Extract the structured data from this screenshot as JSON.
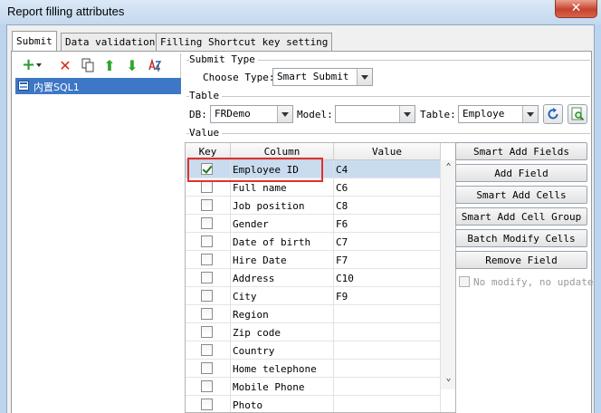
{
  "window": {
    "title": "Report filling attributes",
    "close_glyph": "✕"
  },
  "tabs": [
    {
      "label": "Submit",
      "active": true
    },
    {
      "label": "Data validation",
      "active": false
    },
    {
      "label": "Filling Shortcut key setting",
      "active": false
    }
  ],
  "toolbar": {
    "icons": [
      "add-dropdown-icon",
      "delete-icon",
      "copy-icon",
      "move-up-icon",
      "move-down-icon",
      "sort-icon"
    ],
    "add_glyph": "+",
    "delete_glyph": "✕",
    "up_glyph": "⬆",
    "down_glyph": "⬇"
  },
  "submit_list": {
    "items": [
      {
        "label": "内置SQL1",
        "selected": true
      }
    ]
  },
  "submit_type": {
    "group_label": "Submit Type",
    "choose_label": "Choose Type:",
    "value": "Smart Submit"
  },
  "table_group": {
    "group_label": "Table",
    "db_label": "DB:",
    "db_value": "FRDemo",
    "model_label": "Model:",
    "model_value": "",
    "table_label": "Table:",
    "table_value": "Employe"
  },
  "value_group": {
    "group_label": "Value",
    "columns": [
      "Key",
      "Column",
      "Value"
    ],
    "rows": [
      {
        "key": true,
        "column": "Employee ID",
        "value": "C4",
        "selected": true
      },
      {
        "key": false,
        "column": "Full name",
        "value": "C6"
      },
      {
        "key": false,
        "column": "Job position",
        "value": "C8"
      },
      {
        "key": false,
        "column": "Gender",
        "value": "F6"
      },
      {
        "key": false,
        "column": "Date of birth",
        "value": "C7"
      },
      {
        "key": false,
        "column": "Hire Date",
        "value": "F7"
      },
      {
        "key": false,
        "column": "Address",
        "value": "C10"
      },
      {
        "key": false,
        "column": "City",
        "value": "F9"
      },
      {
        "key": false,
        "column": "Region",
        "value": ""
      },
      {
        "key": false,
        "column": "Zip code",
        "value": ""
      },
      {
        "key": false,
        "column": "Country",
        "value": ""
      },
      {
        "key": false,
        "column": "Home telephone",
        "value": ""
      },
      {
        "key": false,
        "column": "Mobile Phone",
        "value": ""
      },
      {
        "key": false,
        "column": "Photo",
        "value": ""
      }
    ],
    "scroll_up_glyph": "⌃",
    "scroll_down_glyph": "⌄"
  },
  "side_buttons": [
    "Smart Add Fields",
    "Add Field",
    "Smart Add Cells",
    "Smart Add Cell Group",
    "Batch Modify Cells",
    "Remove Field"
  ],
  "no_modify": {
    "label": "No modify, no update",
    "checked": false,
    "enabled": false
  },
  "colors": {
    "selection": "#3e77c6",
    "row_selected": "#c9dcef",
    "highlight_box": "#e0302c",
    "titlebar": "#c4d8ee"
  }
}
